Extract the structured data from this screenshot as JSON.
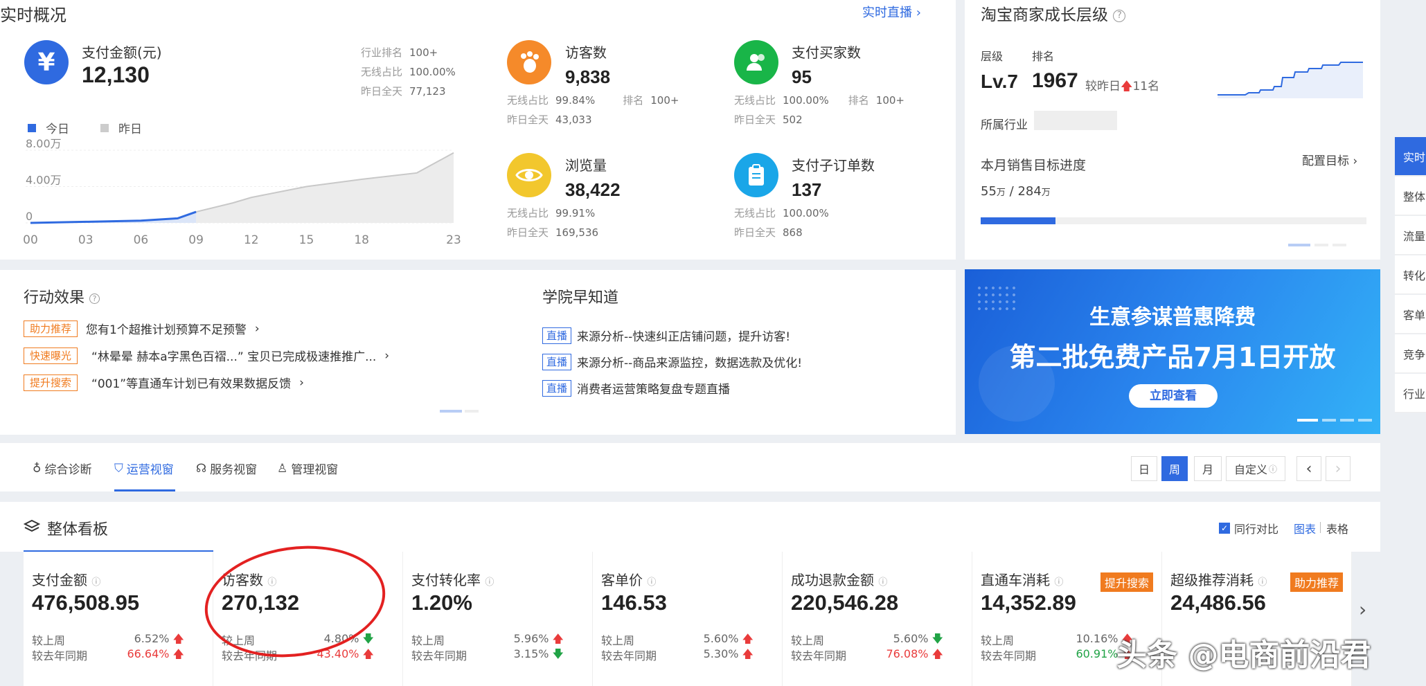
{
  "realtime": {
    "title": "实时概况",
    "live_link": "实时直播",
    "payment": {
      "label": "支付金额(元)",
      "value": "12,130",
      "industry_rank_label": "行业排名",
      "industry_rank": "100+",
      "wireless_label": "无线占比",
      "wireless": "100.00%",
      "yesterday_label": "昨日全天",
      "yesterday": "77,123"
    },
    "legend": {
      "today": "今日",
      "yesterday": "昨日"
    },
    "chart_data": {
      "type": "area",
      "x_ticks": [
        "00",
        "03",
        "06",
        "09",
        "12",
        "15",
        "18",
        "23"
      ],
      "y_ticks": [
        "8.00万",
        "4.00万",
        "0"
      ],
      "ylim": [
        0,
        80000
      ],
      "series": [
        {
          "name": "今日",
          "x": [
            0,
            3,
            6,
            8,
            9
          ],
          "values": [
            0,
            1200,
            2500,
            5000,
            12130
          ]
        },
        {
          "name": "昨日",
          "x": [
            9,
            11,
            12,
            15,
            18,
            21,
            23
          ],
          "values": [
            12130,
            22000,
            28000,
            40000,
            48000,
            55000,
            77123
          ]
        }
      ]
    },
    "visitors": {
      "label": "访客数",
      "value": "9,838",
      "wireless_label": "无线占比",
      "wireless": "99.84%",
      "rank_label": "排名",
      "rank": "100+",
      "yesterday_label": "昨日全天",
      "yesterday": "43,033"
    },
    "buyers": {
      "label": "支付买家数",
      "value": "95",
      "wireless_label": "无线占比",
      "wireless": "100.00%",
      "rank_label": "排名",
      "rank": "100+",
      "yesterday_label": "昨日全天",
      "yesterday": "502"
    },
    "pageviews": {
      "label": "浏览量",
      "value": "38,422",
      "wireless_label": "无线占比",
      "wireless": "99.91%",
      "yesterday_label": "昨日全天",
      "yesterday": "169,536"
    },
    "suborders": {
      "label": "支付子订单数",
      "value": "137",
      "wireless_label": "无线占比",
      "wireless": "100.00%",
      "yesterday_label": "昨日全天",
      "yesterday": "868"
    }
  },
  "growth": {
    "title": "淘宝商家成长层级",
    "level_label": "层级",
    "level": "Lv.7",
    "rank_label": "排名",
    "rank": "1967",
    "rank_change_prefix": "较昨日",
    "rank_change": "11名",
    "industry_label": "所属行业",
    "sales_target_title": "本月销售目标进度",
    "config_link": "配置目标",
    "progress_current": "55",
    "progress_target": "284",
    "unit": "万",
    "progress_fraction": 0.194
  },
  "actions": {
    "title": "行动效果",
    "items": [
      {
        "tag": "助力推荐",
        "text": "您有1个超推计划预算不足预警"
      },
      {
        "tag": "快速曝光",
        "text": "“林晕晕 赫本a字黑色百褶...” 宝贝已完成极速推推广..."
      },
      {
        "tag": "提升搜索",
        "text": "“001”等直通车计划已有效果数据反馈"
      }
    ]
  },
  "academy": {
    "title": "学院早知道",
    "items": [
      {
        "tag": "直播",
        "text": "来源分析--快速纠正店铺问题，提升访客!"
      },
      {
        "tag": "直播",
        "text": "来源分析--商品来源监控，数据选款及优化!"
      },
      {
        "tag": "直播",
        "text": "消费者运营策略复盘专题直播"
      }
    ]
  },
  "banner": {
    "line1": "生意参谋普惠降费",
    "line2": "第二批免费产品7月1日开放",
    "button": "立即查看"
  },
  "tabs": [
    "综合诊断",
    "运营视窗",
    "服务视窗",
    "管理视窗"
  ],
  "date_buttons": {
    "day": "日",
    "week": "周",
    "month": "月",
    "custom": "自定义"
  },
  "dashboard": {
    "title": "整体看板",
    "compare_label": "同行对比",
    "view_chart": "图表",
    "view_table": "表格",
    "wow_label": "较上周",
    "yoy_label": "较去年同期",
    "kpis": [
      {
        "label": "支付金额",
        "value": "476,508.95",
        "wow": "6.52%",
        "wow_dir": "up",
        "yoy": "66.64%",
        "yoy_dir": "up",
        "yoy_red": true
      },
      {
        "label": "访客数",
        "value": "270,132",
        "wow": "4.80%",
        "wow_dir": "down",
        "yoy": "43.40%",
        "yoy_dir": "up",
        "yoy_red": true
      },
      {
        "label": "支付转化率",
        "value": "1.20%",
        "wow": "5.96%",
        "wow_dir": "up",
        "yoy": "3.15%",
        "yoy_dir": "down"
      },
      {
        "label": "客单价",
        "value": "146.53",
        "wow": "5.60%",
        "wow_dir": "up",
        "yoy": "5.30%",
        "yoy_dir": "up"
      },
      {
        "label": "成功退款金额",
        "value": "220,546.28",
        "wow": "5.60%",
        "wow_dir": "down",
        "yoy": "76.08%",
        "yoy_dir": "up",
        "yoy_red": true
      },
      {
        "label": "直通车消耗",
        "value": "14,352.89",
        "badge": "提升搜索",
        "wow": "10.16%",
        "wow_dir": "up",
        "yoy": "60.91%",
        "yoy_dir": "up",
        "yoy_green": true
      },
      {
        "label": "超级推荐消耗",
        "value": "24,486.56",
        "badge": "助力推荐",
        "wow": "",
        "wow_dir": "",
        "yoy": "",
        "yoy_dir": ""
      }
    ]
  },
  "side_tabs": [
    "实时",
    "整体",
    "流量",
    "转化",
    "客单",
    "竞争",
    "行业"
  ],
  "watermark": "头条 @电商前沿君"
}
